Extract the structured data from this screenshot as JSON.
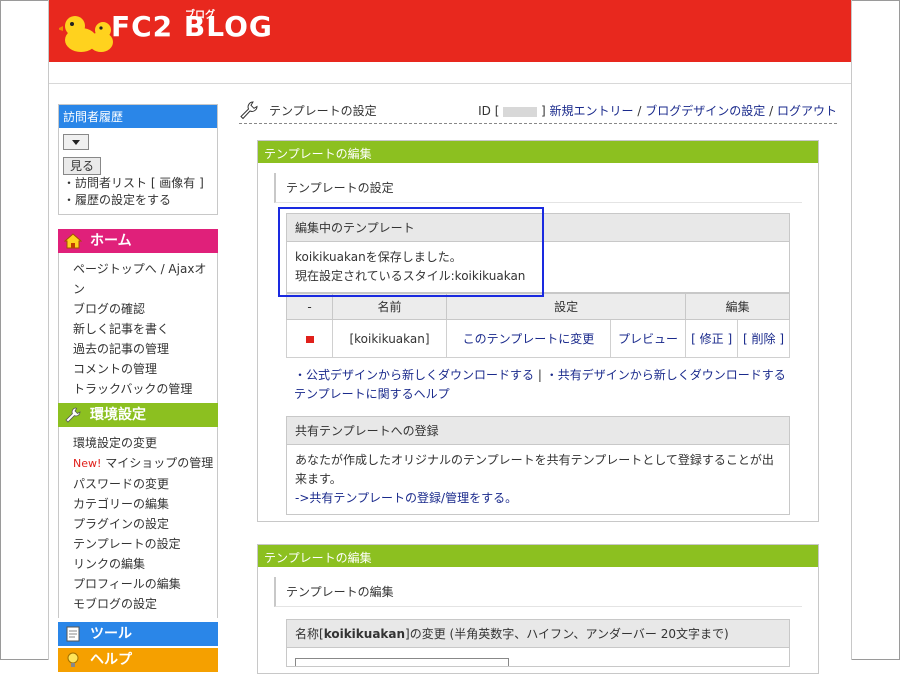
{
  "header": {
    "logo_text": "FC2 BLOG",
    "logo_sub": "ブログ"
  },
  "sidebar": {
    "visitor": {
      "title": "訪問者履歴",
      "view_button": "見る",
      "links": [
        "・訪問者リスト [ 画像有 ]",
        "・履歴の設定をする"
      ]
    },
    "home": {
      "title": "ホーム",
      "items": [
        "ページトップへ / Ajaxオン",
        "ブログの確認",
        "新しく記事を書く",
        "過去の記事の管理",
        "コメントの管理",
        "トラックバックの管理"
      ]
    },
    "settings": {
      "title": "環境設定",
      "new_badge": "New!",
      "items": [
        "環境設定の変更",
        "マイショップの管理",
        "パスワードの変更",
        "カテゴリーの編集",
        "プラグインの設定",
        "テンプレートの設定",
        "リンクの編集",
        "プロフィールの編集",
        "モブログの設定"
      ]
    },
    "tools": {
      "title": "ツール"
    },
    "help": {
      "title": "ヘルプ"
    }
  },
  "main": {
    "page_title": "テンプレートの設定",
    "topnav": {
      "id_prefix": "ID [",
      "id_suffix": "]",
      "new_entry": "新規エントリー",
      "sep": "/",
      "blog_design": "ブログデザインの設定",
      "logout": "ログアウト"
    },
    "panel1": {
      "header": "テンプレートの編集",
      "subhead": "テンプレートの設定",
      "editing": {
        "title": "編集中のテンプレート",
        "saved_msg": "koikikuakanを保存しました。",
        "current_style": "現在設定されているスタイル:koikikuakan"
      },
      "table": {
        "headers": [
          "-",
          "名前",
          "設定",
          "編集"
        ],
        "row": {
          "name": "[koikikuakan]",
          "change": "このテンプレートに変更",
          "preview": "プレビュー",
          "edit": "[ 修正 ]",
          "delete": "[ 削除 ]"
        }
      },
      "links": {
        "official": "・公式デザインから新しくダウンロードする",
        "shared": "・共有デザインから新しくダウンロードする",
        "sep": "|",
        "help": "テンプレートに関するヘルプ"
      },
      "shared": {
        "title": "共有テンプレートへの登録",
        "desc": "あなたが作成したオリジナルのテンプレートを共有テンプレートとして登録することが出来ます。",
        "link": "->共有テンプレートの登録/管理をする。"
      }
    },
    "panel2": {
      "header": "テンプレートの編集",
      "subhead": "テンプレートの編集",
      "name_label_prefix": "名称[",
      "name_value": "koikikuakan",
      "name_label_suffix": "]の変更 (半角英数字、ハイフン、アンダーバー 20文字まで)"
    }
  }
}
